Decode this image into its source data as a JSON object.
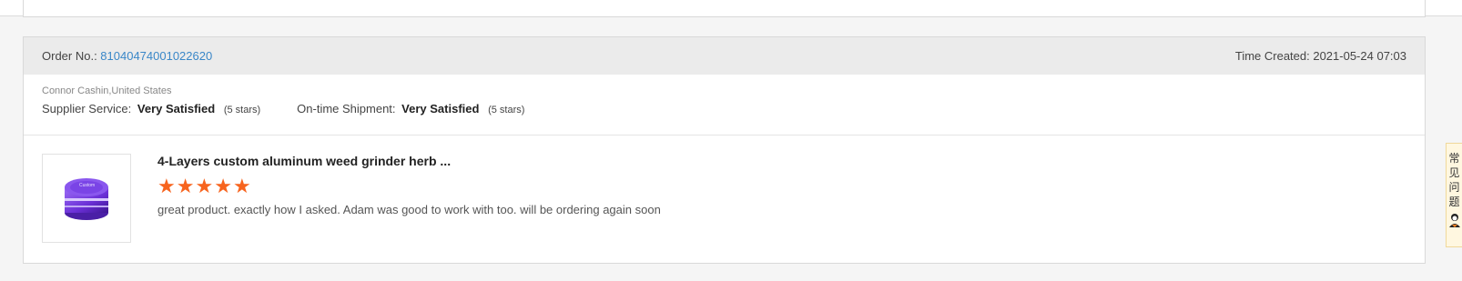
{
  "order": {
    "order_no_label": "Order No.: ",
    "order_no": "81040474001022620",
    "time_created": "Time Created: 2021-05-24 07:03"
  },
  "buyer": "Connor Cashin,United States",
  "ratings": {
    "supplier": {
      "label": "Supplier Service:",
      "value": "Very Satisfied",
      "stars_text": "(5 stars)"
    },
    "shipment": {
      "label": "On-time Shipment:",
      "value": "Very Satisfied",
      "stars_text": "(5 stars)"
    }
  },
  "product": {
    "title": "4-Layers custom aluminum weed grinder herb ...",
    "rating": 5,
    "comment": "great product. exactly how I asked. Adam was good to work with too. will be ordering again soon"
  },
  "help_tab": {
    "chars": [
      "常",
      "见",
      "问",
      "题"
    ]
  },
  "colors": {
    "accent": "#3a87c8",
    "star": "#f7641e",
    "header_bg": "#ebebeb"
  },
  "icons": [
    "star-icon",
    "support-agent-icon",
    "grinder-product-image"
  ]
}
